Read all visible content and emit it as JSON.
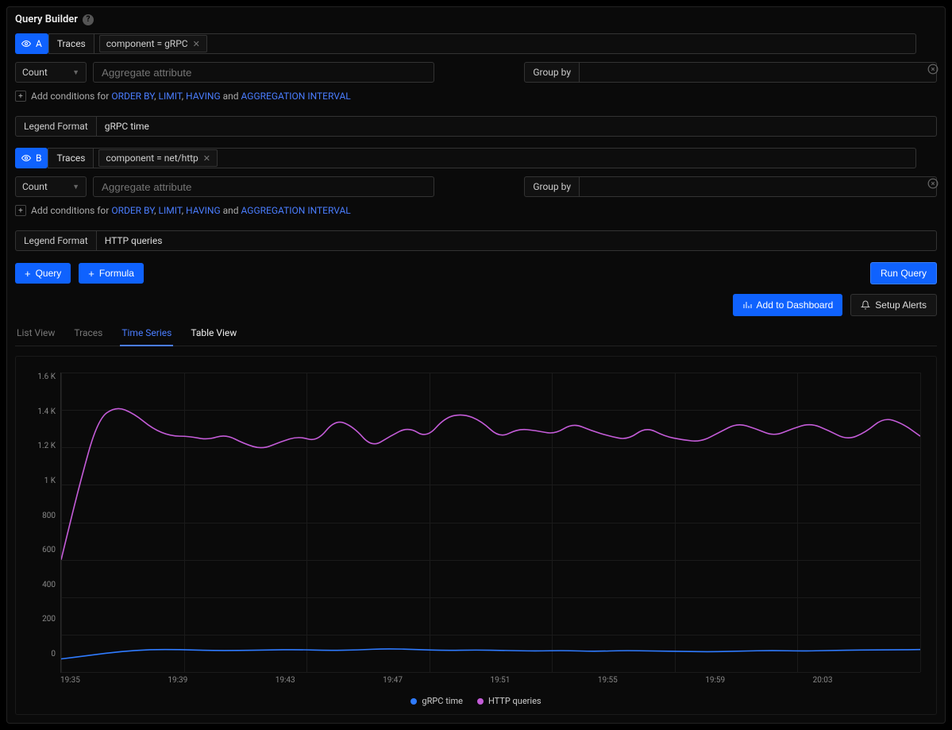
{
  "header": {
    "title": "Query Builder"
  },
  "queries": [
    {
      "id": "A",
      "source": "Traces",
      "filter_chip": "component = gRPC",
      "aggregate": "Count",
      "aggregate_placeholder": "Aggregate attribute",
      "groupby_label": "Group by",
      "legend_label": "Legend Format",
      "legend_value": "gRPC time"
    },
    {
      "id": "B",
      "source": "Traces",
      "filter_chip": "component = net/http",
      "aggregate": "Count",
      "aggregate_placeholder": "Aggregate attribute",
      "groupby_label": "Group by",
      "legend_label": "Legend Format",
      "legend_value": "HTTP queries"
    }
  ],
  "conditions": {
    "prefix": "Add conditions for",
    "links": [
      "ORDER BY",
      "LIMIT",
      "HAVING",
      "AGGREGATION INTERVAL"
    ],
    "sep1": ", ",
    "sep_and": " and "
  },
  "buttons": {
    "query": "Query",
    "formula": "Formula",
    "run": "Run Query",
    "add_dashboard": "Add to Dashboard",
    "setup_alerts": "Setup Alerts"
  },
  "tabs": [
    "List View",
    "Traces",
    "Time Series",
    "Table View"
  ],
  "active_tab": "Time Series",
  "chart_data": {
    "type": "line",
    "y_ticks": [
      "1.6 K",
      "1.4 K",
      "1.2 K",
      "1 K",
      "800",
      "600",
      "400",
      "200",
      "0"
    ],
    "x_ticks": [
      "19:35",
      "19:39",
      "19:43",
      "19:47",
      "19:51",
      "19:55",
      "19:59",
      "20:03"
    ],
    "ylim": [
      0,
      1600
    ],
    "series": [
      {
        "name": "gRPC time",
        "color": "#2f7bff",
        "values": [
          70,
          90,
          110,
          120,
          120,
          115,
          115,
          118,
          120,
          115,
          118,
          125,
          120,
          115,
          118,
          115,
          112,
          115,
          110,
          115,
          112,
          110,
          108,
          112,
          115,
          112,
          115,
          118,
          118,
          120
        ]
      },
      {
        "name": "HTTP queries",
        "color": "#c45cd8",
        "values": [
          600,
          1000,
          1350,
          1420,
          1380,
          1300,
          1260,
          1260,
          1240,
          1270,
          1220,
          1190,
          1230,
          1260,
          1230,
          1350,
          1310,
          1200,
          1260,
          1310,
          1250,
          1360,
          1380,
          1340,
          1250,
          1300,
          1290,
          1270,
          1330,
          1290,
          1260,
          1240,
          1310,
          1260,
          1240,
          1230,
          1280,
          1330,
          1300,
          1260,
          1300,
          1330,
          1290,
          1240,
          1280,
          1360,
          1330,
          1260
        ]
      }
    ]
  }
}
